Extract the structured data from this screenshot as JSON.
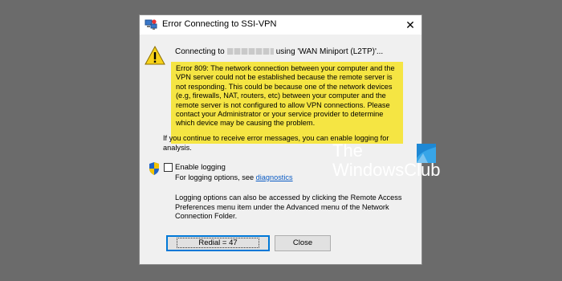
{
  "window": {
    "title": "Error Connecting to SSI-VPN",
    "icons": {
      "title": "network-connection-icon",
      "close": "close-icon"
    },
    "close_glyph": "✕"
  },
  "message": {
    "connecting_prefix": "Connecting to",
    "connecting_suffix": "using 'WAN Miniport (L2TP)'...",
    "error_text": "Error 809: The network connection between your computer and the VPN server could not be established because the remote server is not responding. This could be because one of the network devices (e.g, firewalls, NAT, routers, etc) between your computer and the remote server is not configured to allow VPN connections. Please contact your Administrator or your service provider to determine which device may be causing the problem.",
    "continue_text": "If you continue to receive error messages, you can enable logging for analysis.",
    "icons": {
      "warning": "warning-icon"
    },
    "highlight_color": "#f5e543"
  },
  "logging": {
    "enable_label": "Enable logging",
    "checked": false,
    "options_prefix": "For logging options, see",
    "diagnostics_link": "diagnostics",
    "info_text": "Logging options can also be accessed by clicking the Remote Access Preferences menu item under the Advanced menu of the Network Connection Folder.",
    "icons": {
      "shield": "uac-shield-icon"
    }
  },
  "buttons": {
    "redial_label": "Redial = 47",
    "close_label": "Close"
  },
  "watermark": {
    "line1": "The",
    "line2": "WindowsClub",
    "icon": "windows-logo-icon"
  }
}
